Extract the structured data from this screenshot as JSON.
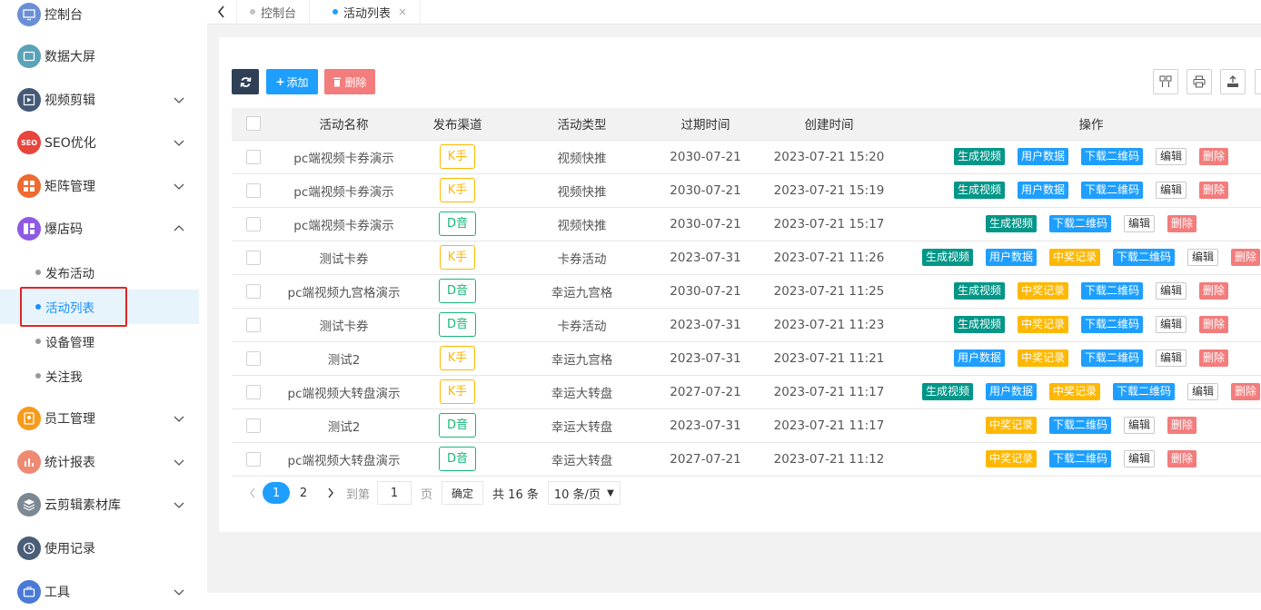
{
  "sidebar": {
    "items": [
      {
        "label": "控制台",
        "icon": "monitor-icon",
        "color": "#6b8fd6"
      },
      {
        "label": "数据大屏",
        "icon": "screen-icon",
        "color": "#5aa2b8"
      },
      {
        "label": "视频剪辑",
        "icon": "video-edit-icon",
        "color": "#455a78"
      },
      {
        "label": "SEO优化",
        "icon": "seo-icon",
        "icon_text": "SEO",
        "color": "#e8453c"
      },
      {
        "label": "矩阵管理",
        "icon": "matrix-icon",
        "color": "#ee6a2f"
      },
      {
        "label": "爆店码",
        "icon": "shop-code-icon",
        "color": "#8e5ae3"
      },
      {
        "label": "员工管理",
        "icon": "staff-icon",
        "color": "#f79a1b"
      },
      {
        "label": "统计报表",
        "icon": "report-icon",
        "color": "#ef8a72"
      },
      {
        "label": "云剪辑素材库",
        "icon": "material-icon",
        "color": "#7c8894"
      },
      {
        "label": "使用记录",
        "icon": "history-icon",
        "color": "#4a5e78"
      },
      {
        "label": "工具",
        "icon": "tool-icon",
        "color": "#4a7ad6"
      }
    ],
    "sub_items": [
      "发布活动",
      "活动列表",
      "设备管理",
      "关注我"
    ]
  },
  "tabs": [
    {
      "label": "控制台",
      "dot_color": "#c2c2c2"
    },
    {
      "label": "活动列表",
      "dot_color": "#1e9fff",
      "close": "×"
    }
  ],
  "toolbar": {
    "add_label": "添加",
    "delete_label": "删除"
  },
  "table": {
    "headers": [
      "活动名称",
      "发布渠道",
      "活动类型",
      "过期时间",
      "创建时间",
      "操作"
    ],
    "rows": [
      {
        "name": "pc端视频卡券演示",
        "channel": "K手",
        "type": "视频快推",
        "expire": "2030-07-21",
        "created": "2023-07-21 15:20",
        "ops": [
          "gen",
          "user",
          "qr",
          "edit",
          "del"
        ]
      },
      {
        "name": "pc端视频卡券演示",
        "channel": "K手",
        "type": "视频快推",
        "expire": "2030-07-21",
        "created": "2023-07-21 15:19",
        "ops": [
          "gen",
          "user",
          "qr",
          "edit",
          "del"
        ]
      },
      {
        "name": "pc端视频卡券演示",
        "channel": "D音",
        "type": "视频快推",
        "expire": "2030-07-21",
        "created": "2023-07-21 15:17",
        "ops": [
          "gen",
          "qr",
          "edit",
          "del"
        ]
      },
      {
        "name": "测试卡券",
        "channel": "K手",
        "type": "卡券活动",
        "expire": "2023-07-31",
        "created": "2023-07-21 11:26",
        "ops": [
          "gen",
          "user",
          "prize",
          "qr",
          "edit",
          "del"
        ]
      },
      {
        "name": "pc端视频九宫格演示",
        "channel": "D音",
        "type": "幸运九宫格",
        "expire": "2030-07-21",
        "created": "2023-07-21 11:25",
        "ops": [
          "gen",
          "prize",
          "qr",
          "edit",
          "del"
        ]
      },
      {
        "name": "测试卡券",
        "channel": "D音",
        "type": "卡券活动",
        "expire": "2023-07-31",
        "created": "2023-07-21 11:23",
        "ops": [
          "gen",
          "prize",
          "qr",
          "edit",
          "del"
        ]
      },
      {
        "name": "测试2",
        "channel": "K手",
        "type": "幸运九宫格",
        "expire": "2023-07-31",
        "created": "2023-07-21 11:21",
        "ops": [
          "user",
          "prize",
          "qr",
          "edit",
          "del"
        ]
      },
      {
        "name": "pc端视频大转盘演示",
        "channel": "K手",
        "type": "幸运大转盘",
        "expire": "2027-07-21",
        "created": "2023-07-21 11:17",
        "ops": [
          "gen",
          "user",
          "prize",
          "qr",
          "edit",
          "del"
        ]
      },
      {
        "name": "测试2",
        "channel": "D音",
        "type": "幸运大转盘",
        "expire": "2023-07-31",
        "created": "2023-07-21 11:17",
        "ops": [
          "prize",
          "qr",
          "edit",
          "del"
        ]
      },
      {
        "name": "pc端视频大转盘演示",
        "channel": "D音",
        "type": "幸运大转盘",
        "expire": "2027-07-21",
        "created": "2023-07-21 11:12",
        "ops": [
          "prize",
          "qr",
          "edit",
          "del"
        ]
      }
    ],
    "op_labels": {
      "gen": "生成视频",
      "user": "用户数据",
      "prize": "中奖记录",
      "qr": "下载二维码",
      "edit": "编辑",
      "del": "删除"
    }
  },
  "pagination": {
    "pages": [
      "1",
      "2"
    ],
    "current": "1",
    "goto_label": "到第",
    "goto_value": "1",
    "page_unit": "页",
    "confirm_label": "确定",
    "total_label": "共 16 条",
    "page_size_label": "10 条/页"
  },
  "colors": {
    "accent": "#1e9fff",
    "dark_button": "#2f4056",
    "danger": "#f37c7c",
    "gen": "#009688",
    "prize": "#ffb800",
    "channel_k": "#ffb800",
    "channel_d": "#16b777"
  }
}
